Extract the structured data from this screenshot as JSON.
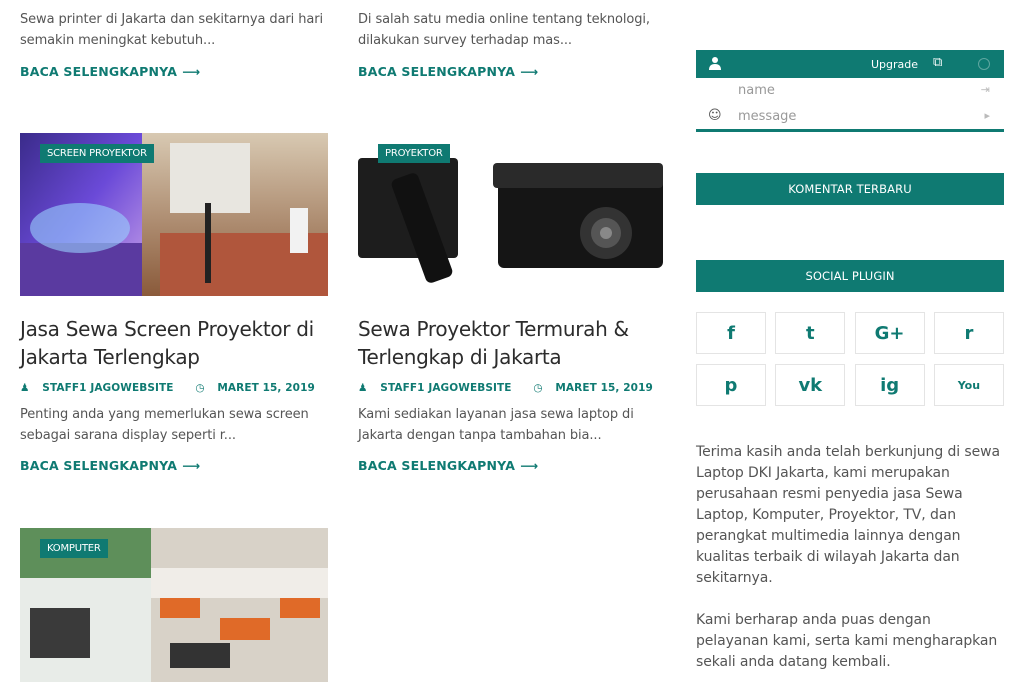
{
  "posts": [
    {
      "excerpt": "Sewa printer di Jakarta dan sekitarnya dari hari semakin meningkat kebutuh...",
      "read_more": "BACA SELENGKAPNYA"
    },
    {
      "excerpt": "Di salah satu media online tentang teknologi, dilakukan survey terhadap mas...",
      "read_more": "BACA SELENGKAPNYA"
    },
    {
      "category": "SCREEN PROYEKTOR",
      "title": "Jasa Sewa Screen Proyektor di Jakarta Terlengkap",
      "author": "STAFF1 JAGOWEBSITE",
      "date": "MARET 15, 2019",
      "excerpt": "Penting anda yang memerlukan sewa screen sebagai sarana display seperti r...",
      "read_more": "BACA SELENGKAPNYA"
    },
    {
      "category": "PROYEKTOR",
      "title": "Sewa Proyektor Termurah & Terlengkap di Jakarta",
      "author": "STAFF1 JAGOWEBSITE",
      "date": "MARET 15, 2019",
      "excerpt": "Kami sediakan layanan jasa sewa laptop di Jakarta dengan tanpa tambahan bia...",
      "read_more": "BACA SELENGKAPNYA"
    },
    {
      "category": "KOMPUTER"
    }
  ],
  "sidebar": {
    "chat": {
      "upgrade": "Upgrade",
      "name_placeholder": "name",
      "message_placeholder": "message"
    },
    "recent_comments": "KOMENTAR TERBARU",
    "social_plugin": "SOCIAL PLUGIN",
    "social_icons": [
      "facebook-icon",
      "twitter-icon",
      "google-plus-icon",
      "reddit-icon",
      "pinterest-icon",
      "vk-icon",
      "instagram-icon",
      "youtube-icon"
    ],
    "social_glyphs": [
      "f",
      "t",
      "G+",
      "r",
      "p",
      "vk",
      "ig",
      "You"
    ],
    "about": [
      "Terima kasih anda telah berkunjung di sewa Laptop DKI Jakarta, kami merupakan perusahaan resmi penyedia jasa Sewa Laptop, Komputer, Proyektor, TV, dan perangkat multimedia lainnya dengan kualitas terbaik di wilayah Jakarta dan sekitarnya.",
      "Kami berharap anda puas dengan pelayanan kami, serta kami mengharapkan sekali anda datang kembali."
    ]
  },
  "colors": {
    "accent": "#0f7a72"
  }
}
